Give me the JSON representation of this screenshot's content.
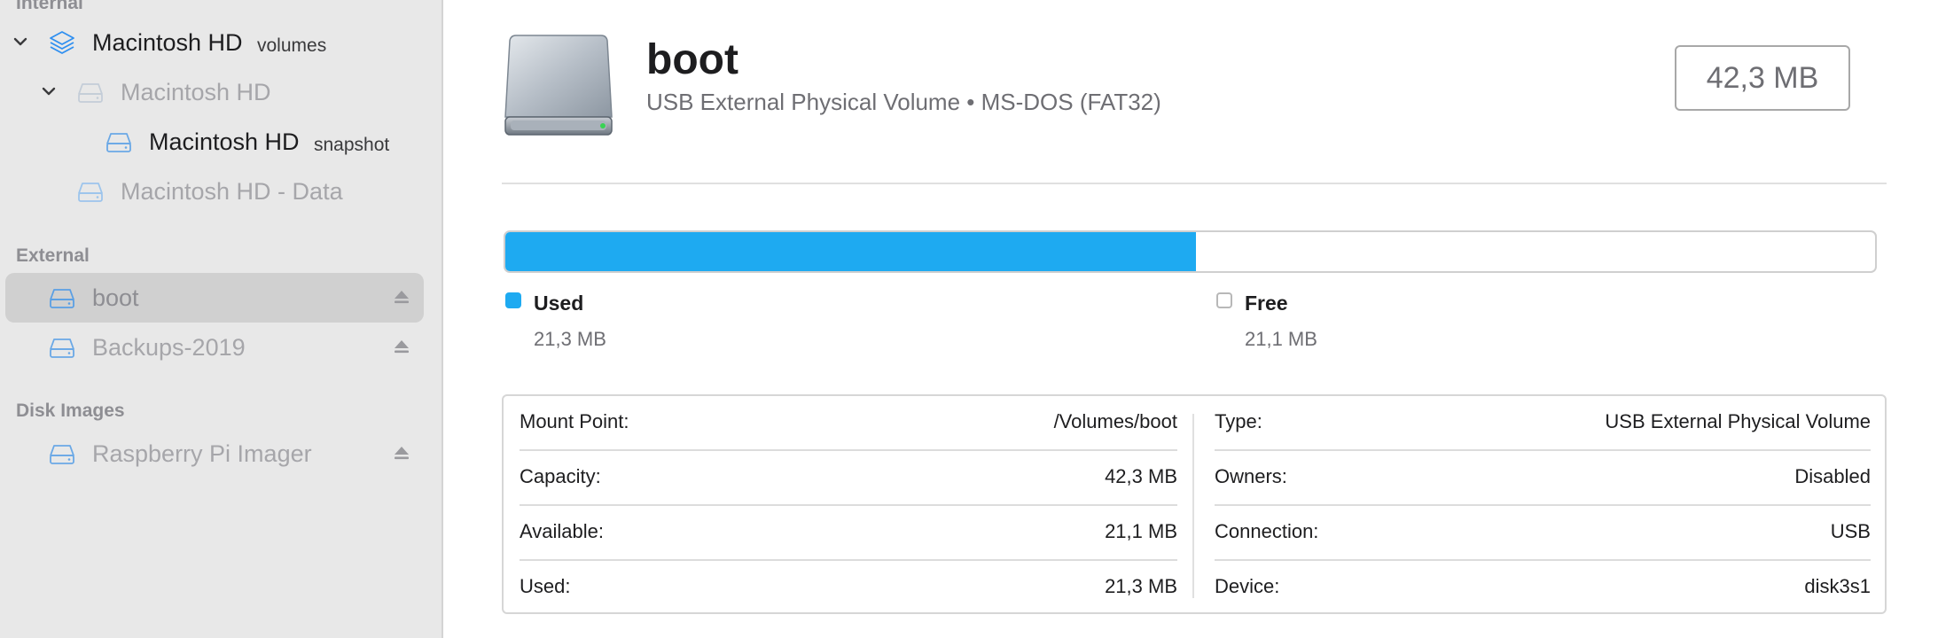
{
  "sidebar": {
    "sections": {
      "internal": "Internal",
      "external": "External",
      "disk_images": "Disk Images"
    },
    "internal_items": [
      {
        "label": "Macintosh HD",
        "suffix": "volumes"
      },
      {
        "label": "Macintosh HD"
      },
      {
        "label": "Macintosh HD",
        "suffix": "snapshot"
      },
      {
        "label": "Macintosh HD - Data"
      }
    ],
    "external_items": [
      {
        "label": "boot",
        "selected": true
      },
      {
        "label": "Backups-2019"
      }
    ],
    "disk_image_items": [
      {
        "label": "Raspberry Pi Imager"
      }
    ]
  },
  "volume": {
    "name": "boot",
    "subtitle": "USB External Physical Volume • MS-DOS (FAT32)",
    "size": "42,3 MB"
  },
  "usage": {
    "used_fraction": 0.504,
    "used_label": "Used",
    "used_value": "21,3 MB",
    "free_label": "Free",
    "free_value": "21,1 MB",
    "used_color": "#1eaaf1"
  },
  "info": {
    "left": [
      {
        "key": "Mount Point:",
        "value": "/Volumes/boot"
      },
      {
        "key": "Capacity:",
        "value": "42,3 MB"
      },
      {
        "key": "Available:",
        "value": "21,1 MB"
      },
      {
        "key": "Used:",
        "value": "21,3 MB"
      }
    ],
    "right": [
      {
        "key": "Type:",
        "value": "USB External Physical Volume"
      },
      {
        "key": "Owners:",
        "value": "Disabled"
      },
      {
        "key": "Connection:",
        "value": "USB"
      },
      {
        "key": "Device:",
        "value": "disk3s1"
      }
    ]
  },
  "icons": {
    "container": "layers-icon",
    "volume": "drive-icon",
    "eject": "eject-icon",
    "disclosure": "chevron-down-icon"
  }
}
